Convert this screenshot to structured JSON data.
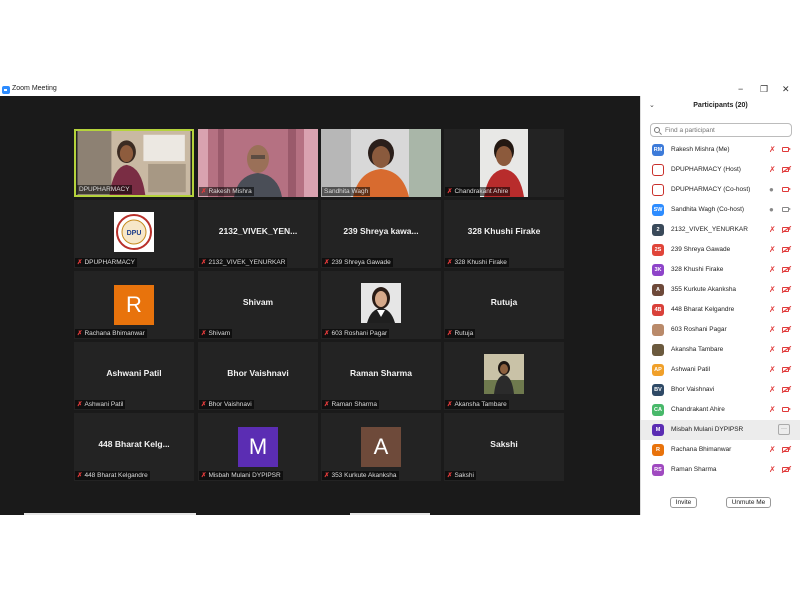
{
  "window": {
    "title": "Zoom Meeting",
    "minimize": "−",
    "restore": "❐",
    "close": "✕"
  },
  "participants_panel": {
    "title": "Participants (20)",
    "collapse_icon": "chevron-down-icon",
    "search_placeholder": "Find a participant",
    "invite_label": "Invite",
    "unmute_label": "Unmute Me"
  },
  "tiles": [
    {
      "id": "t1",
      "name": "DPUPHARMACY",
      "kind": "photo",
      "active": true,
      "muted": false
    },
    {
      "id": "t2",
      "name": "Rakesh Mishra",
      "kind": "photo",
      "muted": true
    },
    {
      "id": "t3",
      "name": "Sandhita Wagh",
      "kind": "photo",
      "muted": false
    },
    {
      "id": "t4",
      "name": "Chandrakant Ahire",
      "kind": "photo",
      "muted": true
    },
    {
      "id": "t5",
      "name": "DPUPHARMACY",
      "kind": "logo",
      "muted": true
    },
    {
      "id": "t6",
      "name": "2132_VIVEK_YENURKAR",
      "big": "2132_VIVEK_YEN...",
      "kind": "text",
      "muted": true
    },
    {
      "id": "t7",
      "name": "239 Shreya Gawade",
      "big": "239 Shreya kawa...",
      "kind": "text",
      "muted": true
    },
    {
      "id": "t8",
      "name": "328 Khushi Firake",
      "big": "328 Khushi Firake",
      "kind": "text",
      "muted": true
    },
    {
      "id": "t9",
      "name": "Rachana Bhimanwar",
      "kind": "letter",
      "letter": "R",
      "color": "#E8730C",
      "muted": true
    },
    {
      "id": "t10",
      "name": "Shivam",
      "big": "Shivam",
      "kind": "text",
      "muted": true
    },
    {
      "id": "t11",
      "name": "603 Roshani Pagar",
      "kind": "photo",
      "muted": true
    },
    {
      "id": "t12",
      "name": "Rutuja",
      "big": "Rutuja",
      "kind": "text",
      "muted": true
    },
    {
      "id": "t13",
      "name": "Ashwani Patil",
      "big": "Ashwani Patil",
      "kind": "text",
      "muted": true
    },
    {
      "id": "t14",
      "name": "Bhor Vaishnavi",
      "big": "Bhor Vaishnavi",
      "kind": "text",
      "muted": true
    },
    {
      "id": "t15",
      "name": "Raman Sharma",
      "big": "Raman Sharma",
      "kind": "text",
      "muted": true
    },
    {
      "id": "t16",
      "name": "Akansha Tambare",
      "kind": "photo",
      "muted": true
    },
    {
      "id": "t17",
      "name": "448 Bharat Kelgandre",
      "big": "448 Bharat Kelg...",
      "kind": "text",
      "muted": true
    },
    {
      "id": "t18",
      "name": "Misbah Mulani DYPIPSR",
      "kind": "letter",
      "letter": "M",
      "color": "#5B2DB3",
      "muted": true
    },
    {
      "id": "t19",
      "name": "353 Kurkute Akanksha",
      "kind": "letter",
      "letter": "A",
      "color": "#6E4A3A",
      "muted": true
    },
    {
      "id": "t20",
      "name": "Sakshi",
      "big": "Sakshi",
      "kind": "text",
      "muted": true
    }
  ],
  "participants": [
    {
      "initials": "RM",
      "name": "Rakesh Mishra (Me)",
      "color": "#3D7BD9",
      "mic": "muted",
      "cam": "on-red"
    },
    {
      "initials": "",
      "name": "DPUPHARMACY (Host)",
      "color": "#C9302C",
      "mic": "muted",
      "cam": "off",
      "logo": true
    },
    {
      "initials": "",
      "name": "DPUPHARMACY (Co-host)",
      "color": "#C9302C",
      "mic": "on",
      "cam": "on-red",
      "logo": true
    },
    {
      "initials": "SW",
      "name": "Sandhita Wagh (Co-host)",
      "color": "#2D8CFF",
      "mic": "on",
      "cam": "grey"
    },
    {
      "initials": "2",
      "name": "2132_VIVEK_YENURKAR",
      "color": "#3A4A5A",
      "mic": "muted",
      "cam": "off"
    },
    {
      "initials": "2S",
      "name": "239 Shreya Gawade",
      "color": "#E0453A",
      "mic": "muted",
      "cam": "off"
    },
    {
      "initials": "3K",
      "name": "328 Khushi Firake",
      "color": "#8E44C9",
      "mic": "muted",
      "cam": "off"
    },
    {
      "initials": "A",
      "name": "355 Kurkute Akanksha",
      "color": "#6E4A3A",
      "mic": "muted",
      "cam": "off"
    },
    {
      "initials": "4B",
      "name": "448 Bharat Kelgandre",
      "color": "#D9413A",
      "mic": "muted",
      "cam": "off"
    },
    {
      "initials": "",
      "name": "603 Roshani Pagar",
      "color": "#B98A6A",
      "mic": "muted",
      "cam": "off",
      "photo": true
    },
    {
      "initials": "",
      "name": "Akansha Tambare",
      "color": "#6B5A3E",
      "mic": "muted",
      "cam": "off",
      "photo": true
    },
    {
      "initials": "AP",
      "name": "Ashwani Patil",
      "color": "#F0A02A",
      "mic": "muted",
      "cam": "off"
    },
    {
      "initials": "BV",
      "name": "Bhor Vaishnavi",
      "color": "#2F4A66",
      "mic": "muted",
      "cam": "off"
    },
    {
      "initials": "CA",
      "name": "Chandrakant Ahire",
      "color": "#48B86A",
      "mic": "muted",
      "cam": "on-red"
    },
    {
      "initials": "M",
      "name": "Misbah Mulani DYPIPSR",
      "color": "#5B2DB3",
      "mic": "",
      "cam": "",
      "more": true,
      "more_label": "···"
    },
    {
      "initials": "R",
      "name": "Rachana Bhimanwar",
      "color": "#E8730C",
      "mic": "muted",
      "cam": "off"
    },
    {
      "initials": "RS",
      "name": "Raman Sharma",
      "color": "#A04AC0",
      "mic": "muted",
      "cam": "off"
    }
  ],
  "logo_text": {
    "top": "DR. D.Y. PATIL",
    "mid": "DPU",
    "bottom": "VIDYAPEETH"
  }
}
